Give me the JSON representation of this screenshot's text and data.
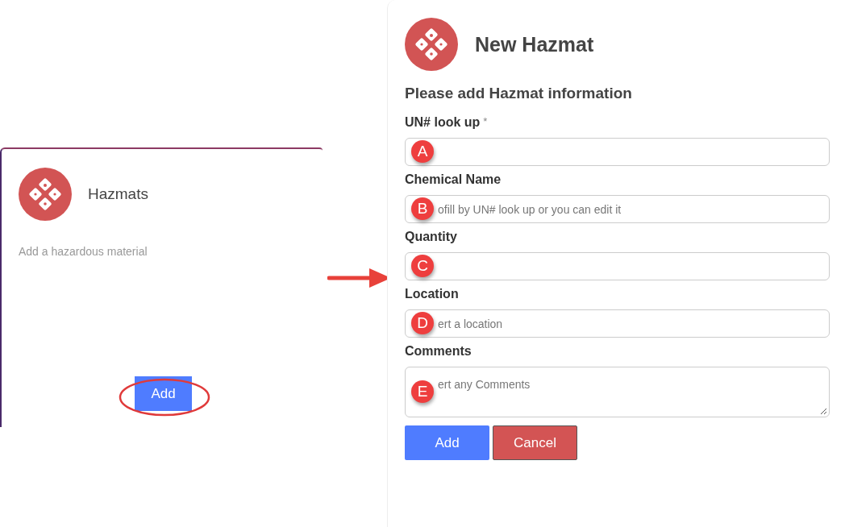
{
  "card": {
    "title": "Hazmats",
    "description": "Add a hazardous material",
    "button": "Add"
  },
  "dialog": {
    "title": "New Hazmat",
    "subtitle": "Please add Hazmat information",
    "fields": [
      {
        "label": "UN# look up",
        "required_mark": "*",
        "kind": "input",
        "badge": "A"
      },
      {
        "label": "Chemical Name",
        "placeholder": "ofill by UN# look up or you can edit it",
        "kind": "input",
        "badge": "B"
      },
      {
        "label": "Quantity",
        "kind": "input",
        "badge": "C"
      },
      {
        "label": "Location",
        "placeholder": "ert a location",
        "kind": "input",
        "badge": "D"
      },
      {
        "label": "Comments",
        "placeholder": "ert any Comments",
        "kind": "textarea",
        "badge": "E"
      }
    ],
    "buttons": [
      {
        "label": "Add",
        "kind": "primary"
      },
      {
        "label": "Cancel",
        "kind": "danger"
      }
    ]
  }
}
